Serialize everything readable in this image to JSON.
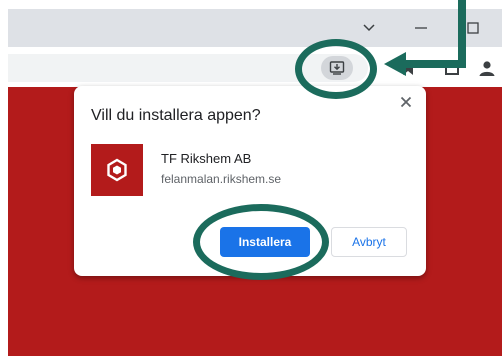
{
  "dialog": {
    "title": "Vill du installera appen?",
    "app_name": "TF Rikshem AB",
    "app_origin": "felanmalan.rikshem.se",
    "install_label": "Installera",
    "cancel_label": "Avbryt",
    "close_icon": "close-icon"
  },
  "browser": {
    "install_icon": "install-app-icon",
    "toolbar_icons": [
      "bookmark-star-icon",
      "tab-search-icon",
      "profile-icon"
    ],
    "window_controls": [
      "tab-list-chevron-icon",
      "minimize-icon",
      "maximize-icon"
    ]
  },
  "colors": {
    "page_background": "#b31b1b",
    "install_button": "#1a73e8",
    "annotation": "#1b6b5c"
  }
}
